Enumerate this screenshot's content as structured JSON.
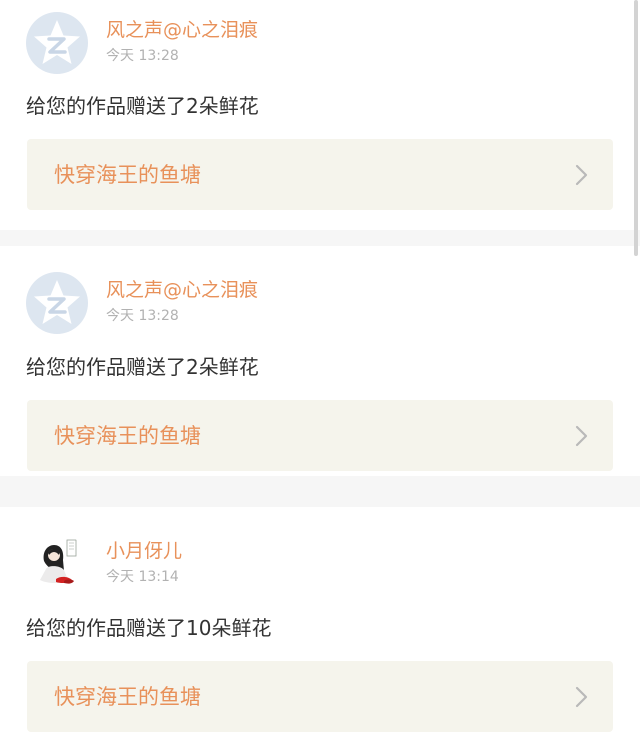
{
  "notifications": [
    {
      "username": "风之声@心之泪痕",
      "time": "今天 13:28",
      "message": "给您的作品赠送了2朵鲜花",
      "work_title": "快穿海王的鱼塘",
      "avatar": "default-avatar-icon"
    },
    {
      "username": "风之声@心之泪痕",
      "time": "今天 13:28",
      "message": "给您的作品赠送了2朵鲜花",
      "work_title": "快穿海王的鱼塘",
      "avatar": "default-avatar-icon"
    },
    {
      "username": "小月伢儿",
      "time": "今天 13:14",
      "message": "给您的作品赠送了10朵鲜花",
      "work_title": "快穿海王的鱼塘",
      "avatar": "user-photo-avatar"
    }
  ],
  "colors": {
    "accent": "#e8915a",
    "text": "#333333",
    "muted": "#b2b2b2",
    "link_bg": "#f5f4ec",
    "page_bg": "#f6f6f6",
    "avatar_bg": "#dde6f0"
  }
}
